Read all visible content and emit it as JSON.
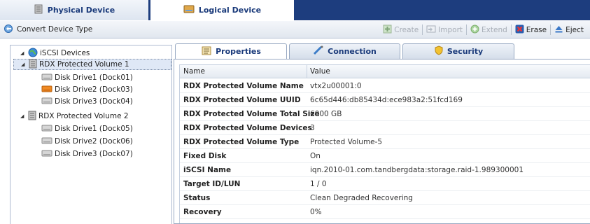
{
  "top_tabs": [
    {
      "label": "Physical Device",
      "icon": "server-icon"
    },
    {
      "label": "Logical Device",
      "icon": "drive-icon"
    }
  ],
  "toolbar": {
    "convert_label": "Convert Device Type",
    "create_label": "Create",
    "import_label": "Import",
    "extend_label": "Extend",
    "erase_label": "Erase",
    "eject_label": "Eject"
  },
  "tree": {
    "root_label": "iSCSI Devices",
    "volumes": [
      {
        "label": "RDX Protected Volume 1",
        "disks": [
          "Disk Drive1 (Dock01)",
          "Disk Drive2 (Dock03)",
          "Disk Drive3 (Dock04)"
        ]
      },
      {
        "label": "RDX Protected Volume 2",
        "disks": [
          "Disk Drive1 (Dock05)",
          "Disk Drive2 (Dock06)",
          "Disk Drive3 (Dock07)"
        ]
      }
    ]
  },
  "property_tabs": [
    {
      "label": "Properties",
      "icon": "properties-icon"
    },
    {
      "label": "Connection",
      "icon": "connection-icon"
    },
    {
      "label": "Security",
      "icon": "shield-icon"
    }
  ],
  "grid": {
    "col_name": "Name",
    "col_value": "Value",
    "rows": [
      {
        "name": "RDX Protected Volume Name",
        "value": "vtx2u00001:0"
      },
      {
        "name": "RDX Protected Volume UUID",
        "value": "6c65d446:db85434d:ece983a2:51fcd169"
      },
      {
        "name": "RDX Protected Volume Total Size",
        "value": "6000 GB"
      },
      {
        "name": "RDX Protected Volume Devices",
        "value": "3"
      },
      {
        "name": "RDX Protected Volume Type",
        "value": "Protected Volume-5"
      },
      {
        "name": "Fixed Disk",
        "value": "On"
      },
      {
        "name": "iSCSI Name",
        "value": "iqn.2010-01.com.tandbergdata:storage.raid-1.989300001"
      },
      {
        "name": "Target ID/LUN",
        "value": "1 / 0"
      },
      {
        "name": "Status",
        "value": "Clean Degraded Recovering"
      },
      {
        "name": "Recovery",
        "value": "0%"
      }
    ]
  },
  "colors": {
    "header_blue": "#1d3d7e",
    "tab_text": "#1a3a7a",
    "disk_warning": "#f08a24"
  }
}
